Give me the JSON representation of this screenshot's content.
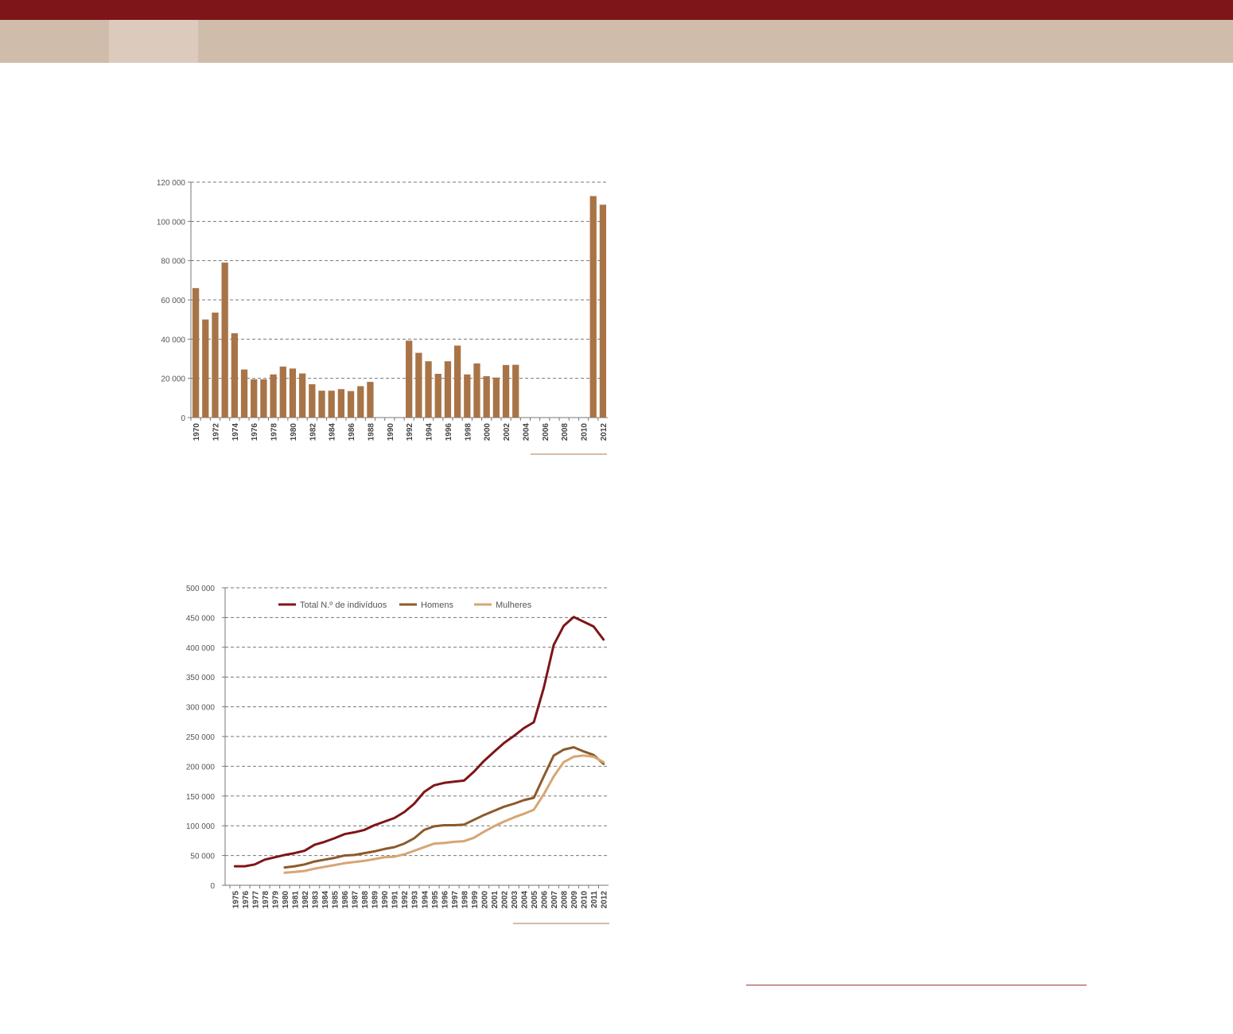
{
  "header": {
    "top_color": "#7e1518",
    "band_color": "#cfbcaa",
    "active_tab_color": "#dccbbd"
  },
  "chart_data": [
    {
      "type": "bar",
      "color": "#a87447",
      "ylim": [
        0,
        120000
      ],
      "yticks": [
        0,
        20000,
        40000,
        60000,
        80000,
        100000,
        120000
      ],
      "ytick_labels": [
        "0",
        "20 000",
        "40 000",
        "60 000",
        "80 000",
        "100 000",
        "120 000"
      ],
      "categories": [
        1970,
        1971,
        1972,
        1973,
        1974,
        1975,
        1976,
        1977,
        1978,
        1979,
        1980,
        1981,
        1982,
        1983,
        1984,
        1985,
        1986,
        1987,
        1988,
        1989,
        1990,
        1991,
        1992,
        1993,
        1994,
        1995,
        1996,
        1997,
        1998,
        1999,
        2000,
        2001,
        2002,
        2003,
        2004,
        2005,
        2006,
        2007,
        2008,
        2009,
        2010,
        2011,
        2012
      ],
      "xtick_labels": [
        "1970",
        "1972",
        "1974",
        "1976",
        "1978",
        "1980",
        "1982",
        "1984",
        "1986",
        "1988",
        "1990",
        "1992",
        "1994",
        "1996",
        "1998",
        "2000",
        "2002",
        "2004",
        "2006",
        "2008",
        "2010",
        "2012"
      ],
      "values": [
        66000,
        50000,
        53500,
        79000,
        43000,
        24500,
        19500,
        19500,
        22000,
        26000,
        25000,
        22500,
        17000,
        13700,
        13700,
        14500,
        13500,
        16000,
        18200,
        0,
        0,
        0,
        39200,
        33000,
        28700,
        22300,
        28700,
        36700,
        22000,
        27600,
        21100,
        20400,
        26800,
        26900,
        0,
        0,
        0,
        0,
        0,
        0,
        0,
        112900,
        108500
      ],
      "grid": true
    },
    {
      "type": "line",
      "ylim": [
        0,
        500000
      ],
      "yticks": [
        0,
        50000,
        100000,
        150000,
        200000,
        250000,
        300000,
        350000,
        400000,
        450000,
        500000
      ],
      "ytick_labels": [
        "0",
        "50 000",
        "100 000",
        "150 000",
        "200 000",
        "250 000",
        "300 000",
        "350 000",
        "400 000",
        "450 000",
        "500 000"
      ],
      "x": [
        1975,
        1976,
        1977,
        1978,
        1979,
        1980,
        1981,
        1982,
        1983,
        1984,
        1985,
        1986,
        1987,
        1988,
        1989,
        1990,
        1991,
        1992,
        1993,
        1994,
        1995,
        1996,
        1997,
        1998,
        1999,
        2000,
        2001,
        2002,
        2003,
        2004,
        2005,
        2006,
        2007,
        2008,
        2009,
        2010,
        2011,
        2012
      ],
      "xtick_labels": [
        "1975",
        "1976",
        "1977",
        "1978",
        "1979",
        "1980",
        "1981",
        "1982",
        "1983",
        "1984",
        "1985",
        "1986",
        "1987",
        "1988",
        "1989",
        "1990",
        "1991",
        "1992",
        "1993",
        "1994",
        "1995",
        "1996",
        "1997",
        "1998",
        "1999",
        "2000",
        "2001",
        "2002",
        "2003",
        "2004",
        "2005",
        "2006",
        "2007",
        "2008",
        "2009",
        "2010",
        "2011",
        "2012"
      ],
      "legend_position": "top",
      "grid": true,
      "series": [
        {
          "name": "Total N.º de indivíduos",
          "color": "#7e1518",
          "values": [
            32000,
            32000,
            35000,
            43000,
            47000,
            51000,
            54000,
            58000,
            68000,
            73000,
            79000,
            86000,
            89000,
            93000,
            101000,
            107000,
            113000,
            123000,
            137000,
            157000,
            168000,
            172000,
            174000,
            176000,
            191000,
            209000,
            224000,
            239000,
            251000,
            264000,
            274000,
            332000,
            404000,
            436000,
            451000,
            443000,
            435000,
            413000
          ]
        },
        {
          "name": "Homens",
          "color": "#8b5a2b",
          "values": [
            null,
            null,
            null,
            null,
            null,
            30000,
            32000,
            35000,
            40000,
            43000,
            46000,
            50000,
            51000,
            54000,
            57000,
            61000,
            64000,
            70000,
            79000,
            93000,
            99000,
            101000,
            101000,
            102000,
            110000,
            118000,
            125000,
            132000,
            137000,
            143000,
            147000,
            183000,
            218000,
            228000,
            232000,
            225000,
            219000,
            204000
          ]
        },
        {
          "name": "Mulheres",
          "color": "#d6a675",
          "values": [
            null,
            null,
            null,
            null,
            null,
            21000,
            22500,
            24000,
            28000,
            31000,
            34000,
            37000,
            39000,
            41000,
            44000,
            47000,
            48000,
            52000,
            58000,
            64000,
            70000,
            71000,
            73000,
            74000,
            80000,
            90000,
            99000,
            107000,
            114000,
            120000,
            127000,
            153000,
            183000,
            207000,
            216000,
            218000,
            216000,
            207000
          ]
        }
      ]
    }
  ]
}
